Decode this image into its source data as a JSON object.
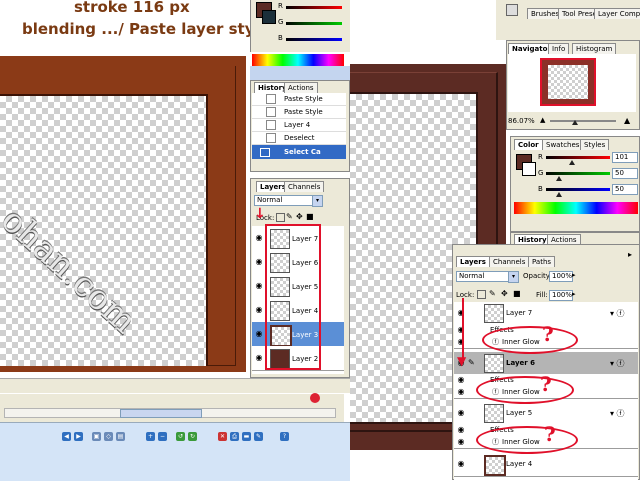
{
  "caption": {
    "line1": "stroke 116 px",
    "line2": "blending .../ Paste layer style"
  },
  "watermark": "ohan.com",
  "colors": {
    "frame_dark": "#5c2b23",
    "frame_orange": "#8b3a17",
    "caption_brown": "#7a3a12",
    "highlight_red": "#e0102a",
    "selected_blue": "#316ac5"
  },
  "mini_color": {
    "labels": [
      "R",
      "G",
      "B"
    ]
  },
  "history_panel": {
    "tabs": [
      "History",
      "Actions"
    ],
    "items": [
      "Paste Style",
      "Paste Style",
      "Layer 4",
      "Deselect",
      "Select Ca"
    ]
  },
  "small_layers_panel": {
    "tabs": [
      "Layers",
      "Channels"
    ],
    "blend_mode": "Normal",
    "lock_label": "Lock:",
    "layers": [
      "Layer 7",
      "Layer 6",
      "Layer 5",
      "Layer 4",
      "Layer 3",
      "Layer 2"
    ],
    "selected": "Layer 3"
  },
  "top_dock": {
    "tabs": [
      "Brushes",
      "Tool Presets",
      "Layer Comps"
    ]
  },
  "navigator_panel": {
    "tabs": [
      "Navigator",
      "Info",
      "Histogram"
    ],
    "zoom": "86.07%"
  },
  "color_panel": {
    "tabs": [
      "Color",
      "Swatches",
      "Styles"
    ],
    "channels": [
      {
        "label": "R",
        "value": "101",
        "level": 0.4
      },
      {
        "label": "G",
        "value": "50",
        "level": 0.2
      },
      {
        "label": "B",
        "value": "50",
        "level": 0.2
      }
    ]
  },
  "history_actions_tabs": [
    "History",
    "Actions"
  ],
  "layers_panel": {
    "tabs": [
      "Layers",
      "Channels",
      "Paths"
    ],
    "blend_mode": "Normal",
    "opacity_label": "Opacity:",
    "opacity": "100%",
    "lock_label": "Lock:",
    "fill_label": "Fill:",
    "fill": "100%",
    "effects_label": "Effects",
    "effect_name": "Inner Glow",
    "layers": [
      "Layer 7",
      "Layer 6",
      "Layer 5",
      "Layer 4"
    ],
    "selected": "Layer 6",
    "question_mark": "?"
  },
  "icons": {
    "eye": "eye-icon",
    "brush": "brush-icon",
    "chain": "link-icon",
    "fx": "fx-icon",
    "lock": "lock-icon"
  }
}
